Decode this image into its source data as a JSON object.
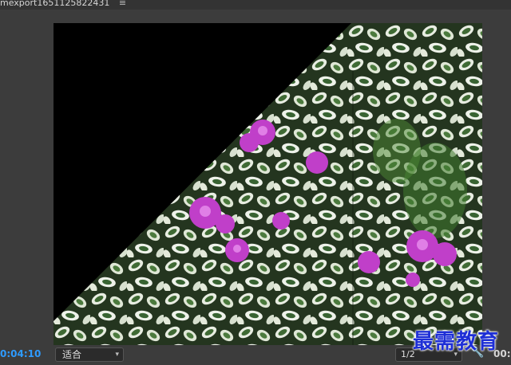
{
  "sequence": {
    "tab_title": "mexport1651125822431",
    "menu_icon": "hamburger-menu-icon"
  },
  "viewer": {
    "content": "crossfade transition between two flower photos (black triangle wipe)"
  },
  "controls": {
    "current_time": "0:04:10",
    "fit_label": "适合",
    "resolution_label": "1/2",
    "duration": "00:"
  },
  "watermark": {
    "text": "最需教育"
  },
  "colors": {
    "timecode": "#2e9bff",
    "watermark": "#1e2fd6",
    "panel_bg": "#3c3c3c"
  }
}
